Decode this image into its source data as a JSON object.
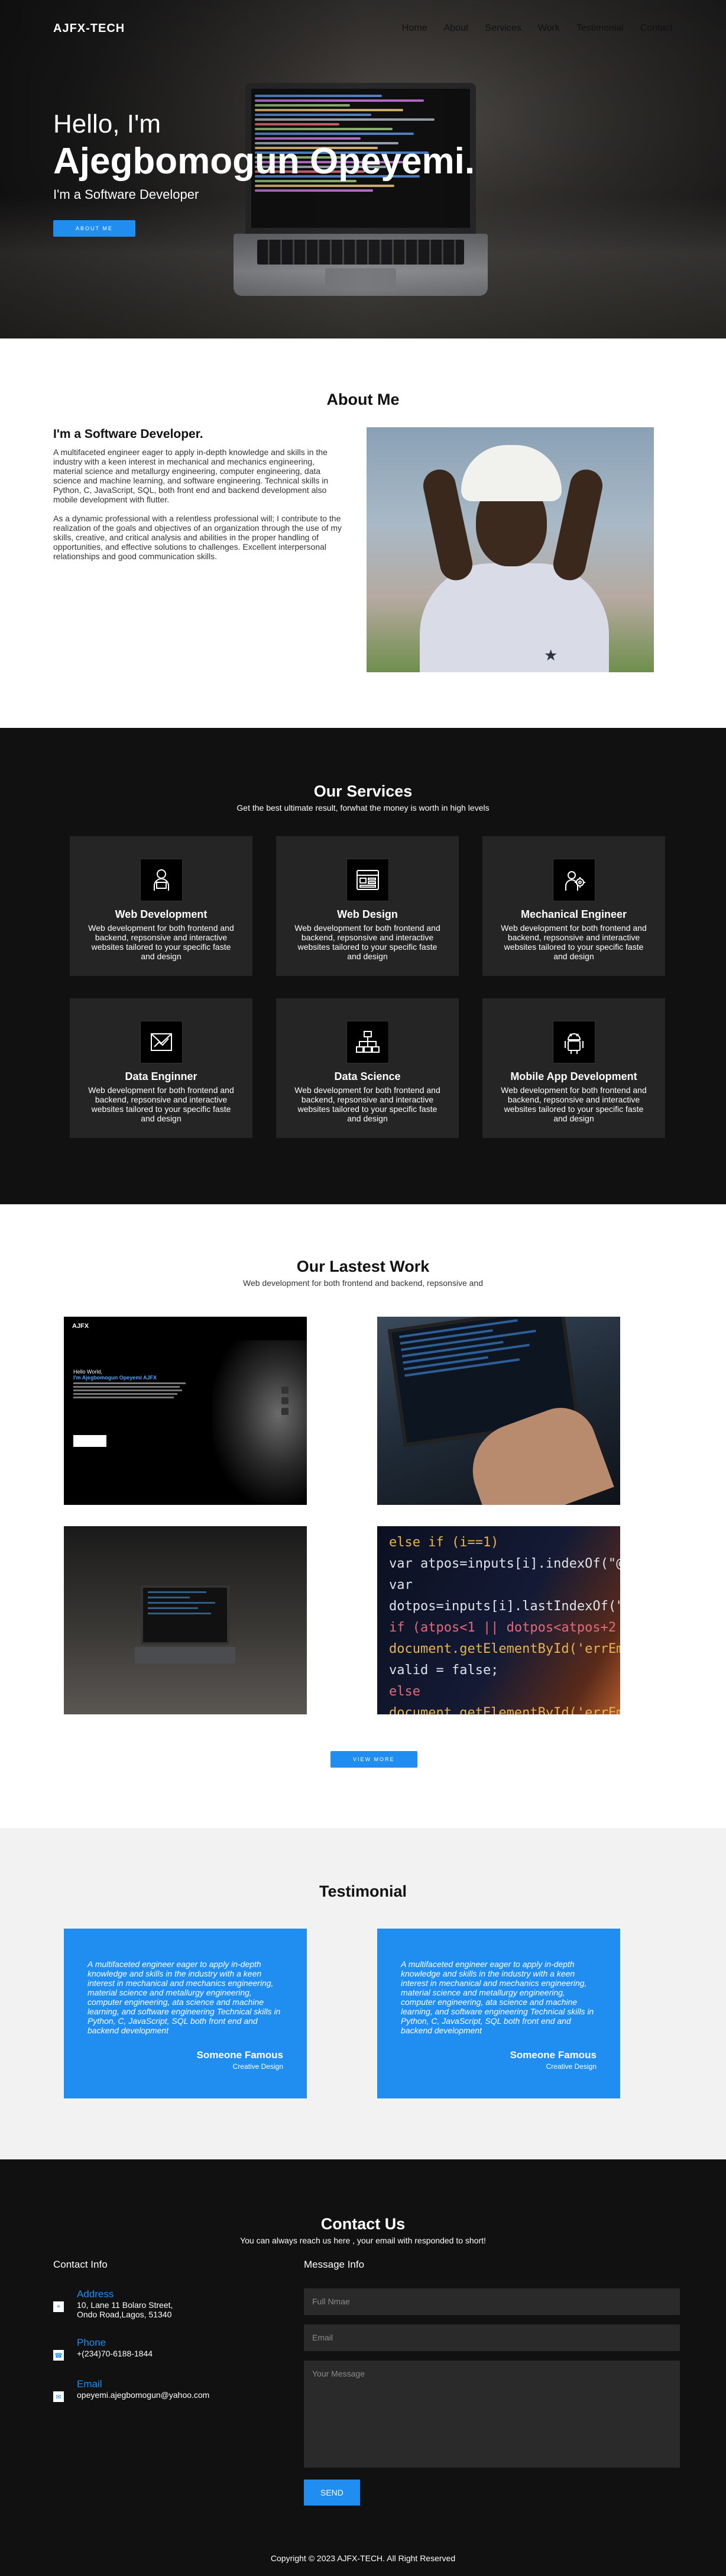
{
  "nav": {
    "brand": "AJFX-TECH",
    "links": [
      "Home",
      "About",
      "Services",
      "Work",
      "Testimonial",
      "Contact"
    ]
  },
  "hero": {
    "greeting": "Hello, I'm",
    "name": "Ajegbomogun Opeyemi.",
    "role": "I'm a Software Developer",
    "button": "ABOUT ME"
  },
  "about": {
    "title": "About Me",
    "heading": "I'm a Software Developer.",
    "p1": "A multifaceted engineer eager to apply in-depth knowledge and skills in the industry with a keen interest in mechanical and mechanics engineering, material science and metallurgy engineering, computer engineering, data science and machine learning, and software engineering. Technical skills in Python, C, JavaScript, SQL, both front end and backend development also mobile development with flutter.",
    "p2": "As a dynamic professional with a relentless professional will; I contribute to the realization of the goals and objectives of an organization through the use of my skills, creative, and critical analysis and abilities in the proper handling of opportunities, and effective solutions to challenges. Excellent interpersonal relationships and good communication skills."
  },
  "services": {
    "title": "Our Services",
    "subtitle": "Get the best ultimate result, forwhat the money is worth in high levels",
    "items": [
      {
        "title": "Web Development",
        "desc": "Web development for both frontend and backend, repsonsive and interactive websites tailored to your specific faste and design",
        "icon": "developer-icon"
      },
      {
        "title": "Web Design",
        "desc": "Web development for both frontend and backend, repsonsive and interactive websites tailored to your specific faste and design",
        "icon": "browser-layout-icon"
      },
      {
        "title": "Mechanical Engineer",
        "desc": "Web development for both frontend and backend, repsonsive and interactive websites tailored to your specific faste and design",
        "icon": "gear-engineer-icon"
      },
      {
        "title": "Data Enginner",
        "desc": "Web development for both frontend and backend, repsonsive and interactive websites tailored to your specific faste and design",
        "icon": "chart-envelope-icon"
      },
      {
        "title": "Data Science",
        "desc": "Web development for both frontend and backend, repsonsive and interactive websites tailored to your specific faste and design",
        "icon": "hierarchy-icon"
      },
      {
        "title": "Mobile App Development",
        "desc": "Web development for both frontend and backend, repsonsive and interactive websites tailored to your specific faste and design",
        "icon": "android-icon"
      }
    ]
  },
  "work": {
    "title": "Our Lastest Work",
    "subtitle": "Web development for both frontend and backend, repsonsive and",
    "mock_brand": "AJFX",
    "mock_hello": "Hello World,",
    "mock_name": "I'm Ajegbomogun Opeyemi AJFX",
    "code_lines": [
      "else if (i==1)",
      "  var atpos=inputs[i].indexOf(\"@\");",
      "  var dotpos=inputs[i].lastIndexOf(\".\");",
      "  if (atpos<1 || dotpos<atpos+2",
      "    document.getElementById('errEmail')",
      "    valid = false;",
      "  else",
      "    document.getElementById('errEmail')"
    ],
    "button": "VIEW MORE"
  },
  "testimonial": {
    "title": "Testimonial",
    "items": [
      {
        "quote": "A multifaceted engineer eager to apply in-depth knowledge and skills in the industry with a keen interest in mechanical and mechanics engineering, material science and metallurgy engineering, computer engineering, ata science and machine learning, and software engineering Technical skills in Python, C, JavaScript, SQL both front end and backend development",
        "name": "Someone Famous",
        "role": "Creative Design"
      },
      {
        "quote": "A multifaceted engineer eager to apply in-depth knowledge and skills in the industry with a keen interest in mechanical and mechanics engineering, material science and metallurgy engineering, computer engineering, ata science and machine learning, and software engineering Technical skills in Python, C, JavaScript, SQL both front end and backend development",
        "name": "Someone Famous",
        "role": "Creative Design"
      }
    ]
  },
  "contact": {
    "title": "Contact Us",
    "subtitle": "You can always reach us here , your email with responded to short!",
    "info_title": "Contact Info",
    "address_label": "Address",
    "address_value": "10, Lane 11 Bolaro Street, Ondo Road,Lagos, 51340",
    "phone_label": "Phone",
    "phone_value": "+(234)70-6188-1844",
    "email_label": "Email",
    "email_value": "opeyemi.ajegbomogun@yahoo.com",
    "message_title": "Message Info",
    "fullname_placeholder": "Full Nmae",
    "email_placeholder": "Email",
    "message_placeholder": "Your Message",
    "send": "SEND"
  },
  "footer": {
    "copyright": "Copyright © 2023 AJFX-TECH. All Right Reserved"
  },
  "colors": {
    "accent": "#1f8ef0",
    "dark": "#111111",
    "card": "#252525"
  }
}
